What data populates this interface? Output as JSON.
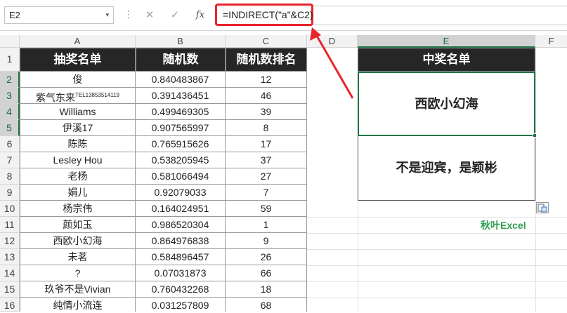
{
  "formula_bar": {
    "name_box": "E2",
    "name_box_arrow": "▾",
    "dots": "⋮",
    "cancel_symbol": "✕",
    "enter_symbol": "✓",
    "fx_label": "fx",
    "formula": "=INDIRECT(\"a\"&C2)"
  },
  "columns": [
    "A",
    "B",
    "C",
    "D",
    "E",
    "F"
  ],
  "rows": [
    "1",
    "2",
    "3",
    "4",
    "5",
    "6",
    "7",
    "8",
    "9",
    "10",
    "11",
    "12",
    "13",
    "14",
    "15",
    "16"
  ],
  "table": {
    "headers": [
      "抽奖名单",
      "随机数",
      "随机数排名"
    ],
    "rows": [
      {
        "name": "俊",
        "rand": "0.840483867",
        "rank": "12"
      },
      {
        "name": "紫气东来",
        "name_sup": "TEL13853514119",
        "rand": "0.391436451",
        "rank": "46"
      },
      {
        "name": "Williams",
        "rand": "0.499469305",
        "rank": "39"
      },
      {
        "name": "伊溪17",
        "rand": "0.907565997",
        "rank": "8"
      },
      {
        "name": "陈陈",
        "rand": "0.765915626",
        "rank": "17"
      },
      {
        "name": "Lesley Hou",
        "rand": "0.538205945",
        "rank": "37"
      },
      {
        "name": "老杨",
        "rand": "0.581066494",
        "rank": "27"
      },
      {
        "name": "娟儿",
        "rand": "0.92079033",
        "rank": "7"
      },
      {
        "name": "杨宗伟",
        "rand": "0.164024951",
        "rank": "59"
      },
      {
        "name": "颜如玉",
        "rand": "0.986520304",
        "rank": "1"
      },
      {
        "name": "西欧小幻海",
        "rand": "0.864976838",
        "rank": "9"
      },
      {
        "name": "未茗",
        "rand": "0.584896457",
        "rank": "26"
      },
      {
        "name": "?",
        "rand": "0.07031873",
        "rank": "66"
      },
      {
        "name": "玖爷不是Vivian",
        "rand": "0.760432268",
        "rank": "18"
      },
      {
        "name": "纯情小流连",
        "rand": "0.031257809",
        "rank": "68"
      }
    ]
  },
  "winners": {
    "header": "中奖名单",
    "items": [
      "西欧小幻海",
      "不是迎宾，是颖彬"
    ]
  },
  "paste_options_icon": "paste-options-icon",
  "brand": "秋叶Excel",
  "colors": {
    "header_bg": "#262626",
    "selection": "#217346",
    "highlight_red": "#e8242c",
    "brand_green": "#2e9e4f"
  }
}
